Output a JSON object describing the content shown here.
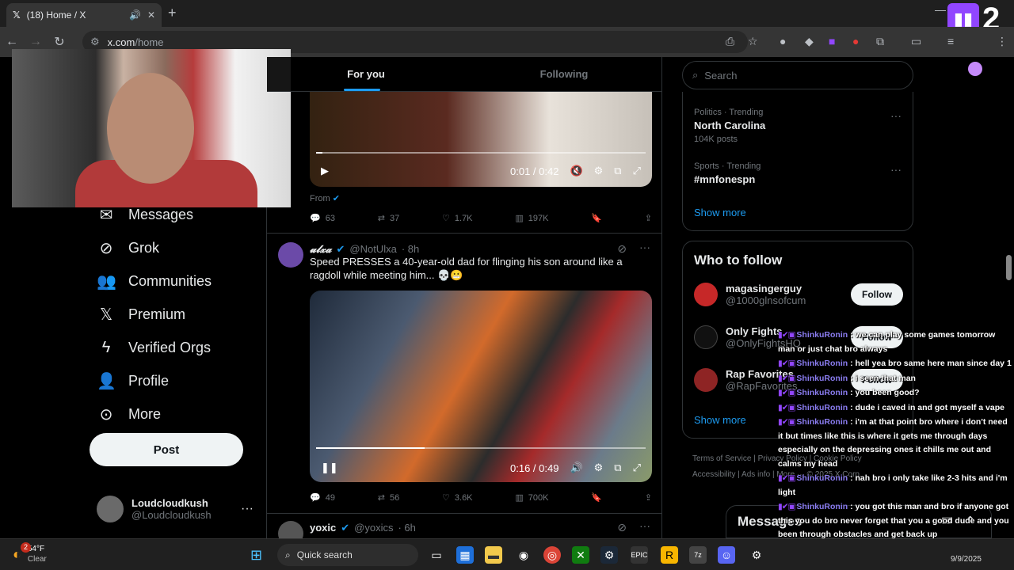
{
  "browser": {
    "tab_title": "(18) Home / X",
    "new_tab": "+",
    "url_host": "x.com",
    "url_path": "/home",
    "minimize": "—"
  },
  "overlay": {
    "twitch_count": "2"
  },
  "left_nav": {
    "items": [
      {
        "label": "Messages",
        "icon": "envelope-icon"
      },
      {
        "label": "Grok",
        "icon": "grok-icon"
      },
      {
        "label": "Communities",
        "icon": "communities-icon"
      },
      {
        "label": "Premium",
        "icon": "x-logo-icon"
      },
      {
        "label": "Verified Orgs",
        "icon": "lightning-icon"
      },
      {
        "label": "Profile",
        "icon": "person-icon"
      },
      {
        "label": "More",
        "icon": "more-circle-icon"
      }
    ],
    "post": "Post",
    "account_name": "Loudcloudkush",
    "account_handle": "@Loudcloudkush"
  },
  "feed": {
    "tabs": [
      "For you",
      "Following"
    ],
    "video1": {
      "time": "0:01 / 0:42",
      "progress": 0.02
    },
    "from_label": "From",
    "tweet1_actions": {
      "replies": "63",
      "reposts": "37",
      "likes": "1.7K",
      "views": "197K"
    },
    "tweet2": {
      "name": "𝓾𝓵𝔁𝓪",
      "handle": "@NotUlxa",
      "time": "· 8h",
      "text": "Speed PRESSES a 40-year-old dad for flinging his son around like a ragdoll while meeting him... 💀😬",
      "video_time": "0:16 / 0:49",
      "progress": 0.33,
      "actions": {
        "replies": "49",
        "reposts": "56",
        "likes": "3.6K",
        "views": "700K"
      }
    },
    "tweet3": {
      "name": "yoxic",
      "handle": "@yoxics",
      "time": "· 6h"
    }
  },
  "right": {
    "search_placeholder": "Search",
    "trends": [
      {
        "category": "Politics · Trending",
        "title": "North Carolina",
        "count": "104K posts"
      },
      {
        "category": "Sports · Trending",
        "title": "#mnfonespn",
        "count": ""
      }
    ],
    "show_more": "Show more",
    "who_to_follow": "Who to follow",
    "follow_suggestions": [
      {
        "name": "magasingerguy",
        "handle": "@1000glnsofcum"
      },
      {
        "name": "Only Fights",
        "handle": "@OnlyFightsHQ"
      },
      {
        "name": "Rap Favorites",
        "handle": "@RapFavorites"
      }
    ],
    "follow_label": "Follow",
    "footer_line1": "Terms of Service  |  Privacy Policy  |  Cookie Policy",
    "footer_line2": "Accessibility  |  Ads info  |  More ···  © 2025 X Corp.",
    "messages": "Messages"
  },
  "chat": [
    {
      "user": "ShinkuRonin",
      "text": "we can play some games tomorrow man or just chat bro always"
    },
    {
      "user": "ShinkuRonin",
      "text": "hell yea bro same here man since day 1"
    },
    {
      "user": "ShinkuRonin",
      "text": "i seen that man"
    },
    {
      "user": "ShinkuRonin",
      "text": "you been good?"
    },
    {
      "user": "ShinkuRonin",
      "text": "dude i caved in and got myself a vape"
    },
    {
      "user": "ShinkuRonin",
      "text": "i'm at that point bro where i don't need it but times like this is where it gets me through days especially on the depressing ones it chills me out and calms my head"
    },
    {
      "user": "ShinkuRonin",
      "text": "nah bro i only take like 2-3 hits and i'm light"
    },
    {
      "user": "ShinkuRonin",
      "text": "you got this man and bro if anyone got this you do bro never forget that you a good dude and you been through obstacles and get back up"
    }
  ],
  "taskbar": {
    "temp": "54°F",
    "condition": "Clear",
    "weather_badge": "2",
    "search": "Quick search",
    "date": "9/9/2025"
  }
}
